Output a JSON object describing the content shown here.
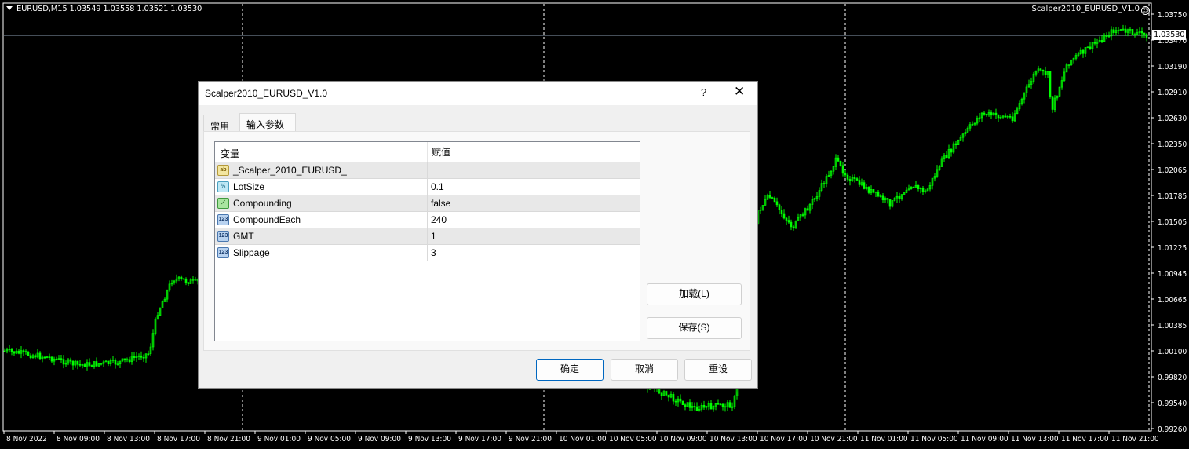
{
  "chart": {
    "symbol_info": "EURUSD,M15  1.03549 1.03558 1.03521 1.03530",
    "expert_label": "Scalper2010_EURUSD_V1.0",
    "expert_icon": "smiley-icon",
    "current_price": "1.03530",
    "price_labels": [
      "1.03750",
      "1.03470",
      "1.03190",
      "1.02910",
      "1.02630",
      "1.02350",
      "1.02065",
      "1.01785",
      "1.01505",
      "1.01225",
      "1.00945",
      "1.00665",
      "1.00385",
      "1.00100",
      "0.99820",
      "0.99540",
      "0.99260"
    ],
    "time_labels": [
      "8 Nov 2022",
      "8 Nov 09:00",
      "8 Nov 13:00",
      "8 Nov 17:00",
      "8 Nov 21:00",
      "9 Nov 01:00",
      "9 Nov 05:00",
      "9 Nov 09:00",
      "9 Nov 13:00",
      "9 Nov 17:00",
      "9 Nov 21:00",
      "10 Nov 01:00",
      "10 Nov 05:00",
      "10 Nov 09:00",
      "10 Nov 13:00",
      "10 Nov 17:00",
      "10 Nov 21:00",
      "11 Nov 01:00",
      "11 Nov 05:00",
      "11 Nov 09:00",
      "11 Nov 13:00",
      "11 Nov 17:00",
      "11 Nov 21:00"
    ],
    "colors": {
      "background": "#000000",
      "candle": "#00ff00",
      "grid": "#ffffff",
      "price_line": "#8a9bb0"
    }
  },
  "dialog": {
    "title": "Scalper2010_EURUSD_V1.0",
    "help": "?",
    "close": "✕",
    "tabs": [
      {
        "label": "常用",
        "active": false
      },
      {
        "label": "输入参数",
        "active": true
      }
    ],
    "table": {
      "headers": [
        "变量",
        "赋值"
      ],
      "rows": [
        {
          "icon": "string-icon",
          "icon_text": "ab",
          "type": "str",
          "name": "_Scalper_2010_EURUSD_",
          "value": ""
        },
        {
          "icon": "double-icon",
          "icon_text": "½",
          "type": "dbl",
          "name": "LotSize",
          "value": "0.1"
        },
        {
          "icon": "bool-icon",
          "icon_text": "⟋",
          "type": "bool",
          "name": "Compounding",
          "value": "false"
        },
        {
          "icon": "int-icon",
          "icon_text": "123",
          "type": "int",
          "name": "CompoundEach",
          "value": "240"
        },
        {
          "icon": "int-icon",
          "icon_text": "123",
          "type": "int",
          "name": "GMT",
          "value": "1"
        },
        {
          "icon": "int-icon",
          "icon_text": "123",
          "type": "int",
          "name": "Slippage",
          "value": "3"
        }
      ]
    },
    "load_button": "加载(L)",
    "save_button": "保存(S)",
    "ok_button": "确定",
    "cancel_button": "取消",
    "reset_button": "重设"
  }
}
